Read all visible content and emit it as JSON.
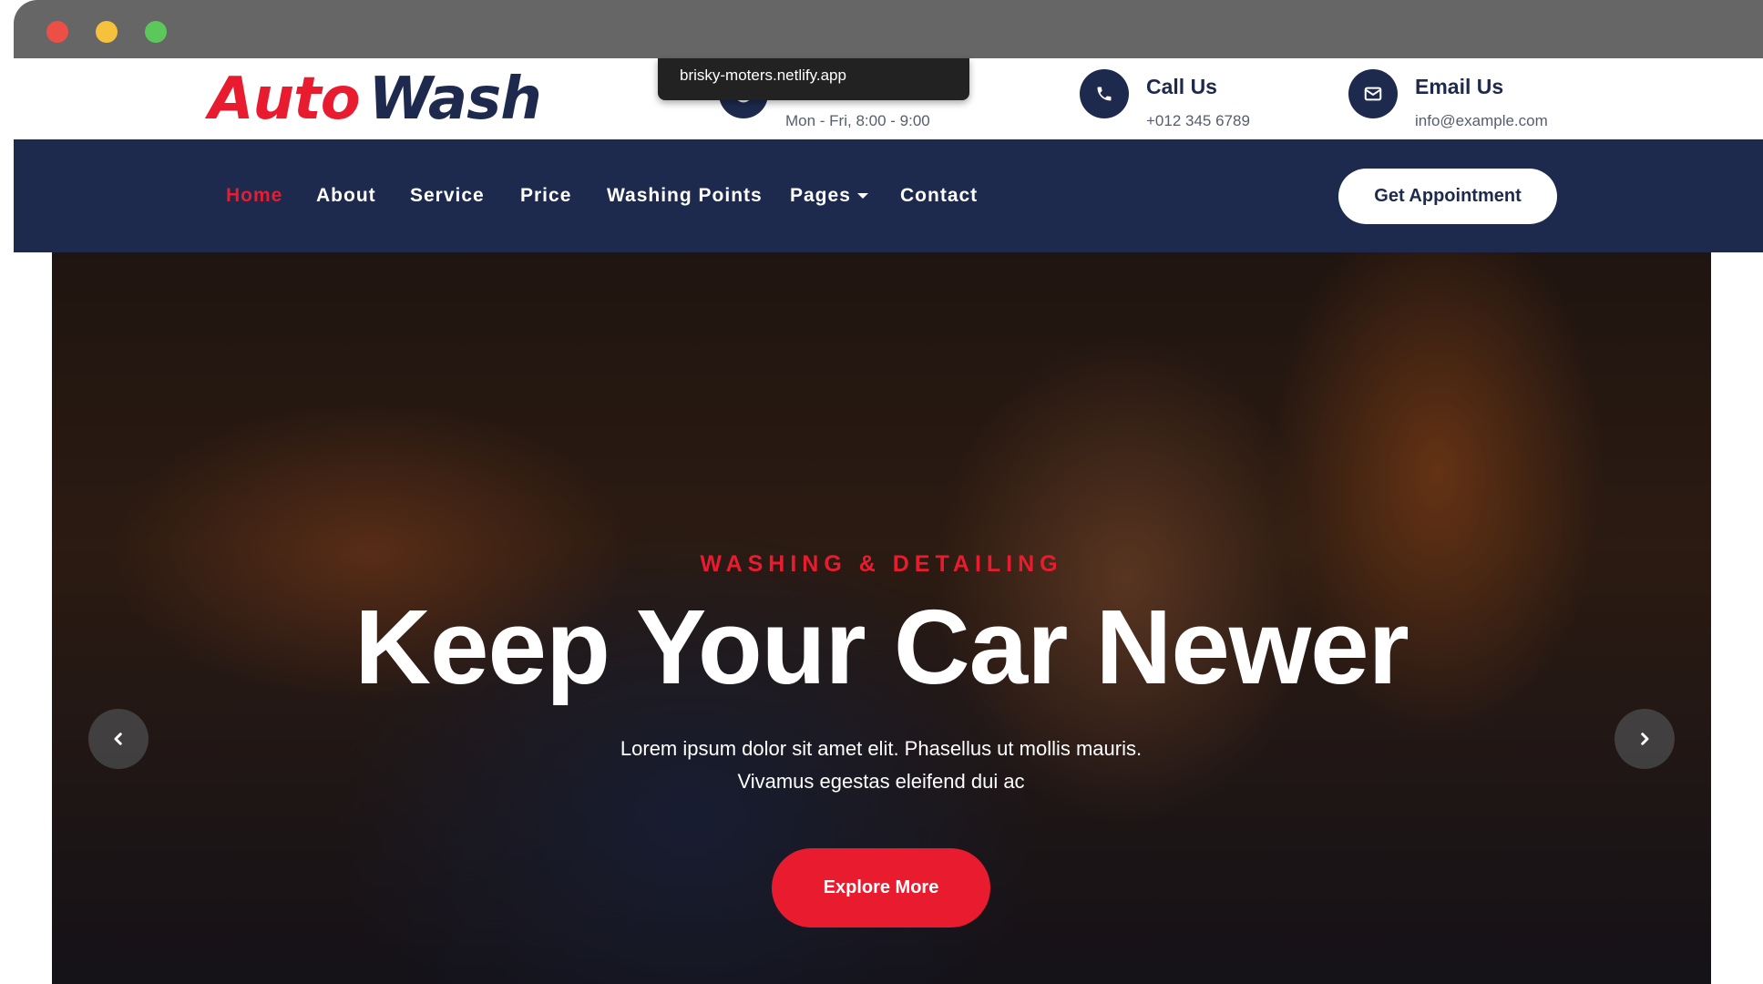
{
  "browser": {
    "tooltip_url": "brisky-moters.netlify.app"
  },
  "brand": {
    "logo_part1": "Auto",
    "logo_part2": "Wash",
    "accent_color": "#e81c2e",
    "primary_color": "#1d2a4d"
  },
  "contacts": [
    {
      "icon": "clock-icon",
      "title": "",
      "value": "Mon - Fri, 8:00 - 9:00"
    },
    {
      "icon": "phone-icon",
      "title": "Call Us",
      "value": "+012 345 6789"
    },
    {
      "icon": "envelope-icon",
      "title": "Email Us",
      "value": "info@example.com"
    }
  ],
  "nav": {
    "items": [
      "Home",
      "About",
      "Service",
      "Price",
      "Washing Points",
      "Pages",
      "Contact"
    ],
    "active": "Home",
    "cta_label": "Get Appointment"
  },
  "hero": {
    "subtitle": "WASHING & DETAILING",
    "title": "Keep Your Car Newer",
    "description_line1": "Lorem ipsum dolor sit amet elit. Phasellus ut mollis mauris.",
    "description_line2": "Vivamus egestas eleifend dui ac",
    "button_label": "Explore More",
    "prev_icon": "chevron-left-icon",
    "next_icon": "chevron-right-icon"
  }
}
